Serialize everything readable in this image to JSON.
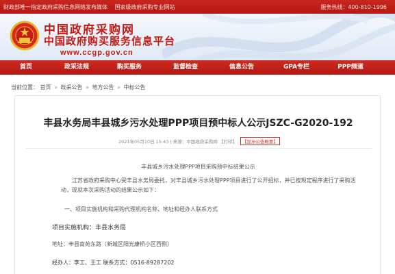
{
  "topbar": {
    "notice_left": "财政部唯一指定政府采购信息网络发布媒体",
    "notice_mid": "国家级政府采购专业网站",
    "hotline": "服务热线：400-810-1996"
  },
  "banner": {
    "site_name": "中国政府采购网",
    "site_subtitle": "中国政府购买服务信息平台",
    "site_url": "www.ccgp.gov.cn"
  },
  "nav": {
    "items": [
      {
        "label": "首页"
      },
      {
        "label": "政采法规"
      },
      {
        "label": "购买服务"
      },
      {
        "label": "监督检查"
      },
      {
        "label": "信息公告"
      },
      {
        "label": "GPA专栏"
      },
      {
        "label": "PPP频道"
      }
    ]
  },
  "breadcrumb": {
    "prefix": "当前位置：",
    "items": [
      "首页",
      "政采公告",
      "地方公告",
      "中标公告"
    ],
    "separator": "»"
  },
  "article": {
    "title": "丰县水务局丰县城乡污水处理PPP项目预中标人公示JSZC-G2020-192",
    "meta_date": "2021年05月10日 15:43",
    "meta_source": "来源：中国政府采购网",
    "meta_print": "【打印】",
    "meta_badge": "【显示公告概要】",
    "subheading": "丰县城乡污水处理PPP项目采购预中标结果公示",
    "paragraph": "江苏省政府采购中心受丰县水务局委托，对丰县城乡污水处理PPP项目进行了公开招标，并已按规定程序进行了采购活动，现就本次采购活动的结果公示如下：",
    "section1": "一、项目实施机构和采购代理机构名称、地址和经办人联系方式",
    "agency": "项目实施机构：丰县水务局",
    "address": "地址：丰县南苑东路（新城区阳光康桥小区西侧）",
    "contact": "经办人：李工、王工 联系方式：0516-89287202"
  },
  "colors": {
    "brand_red": "#c41a14",
    "nav_red": "#b31711"
  }
}
